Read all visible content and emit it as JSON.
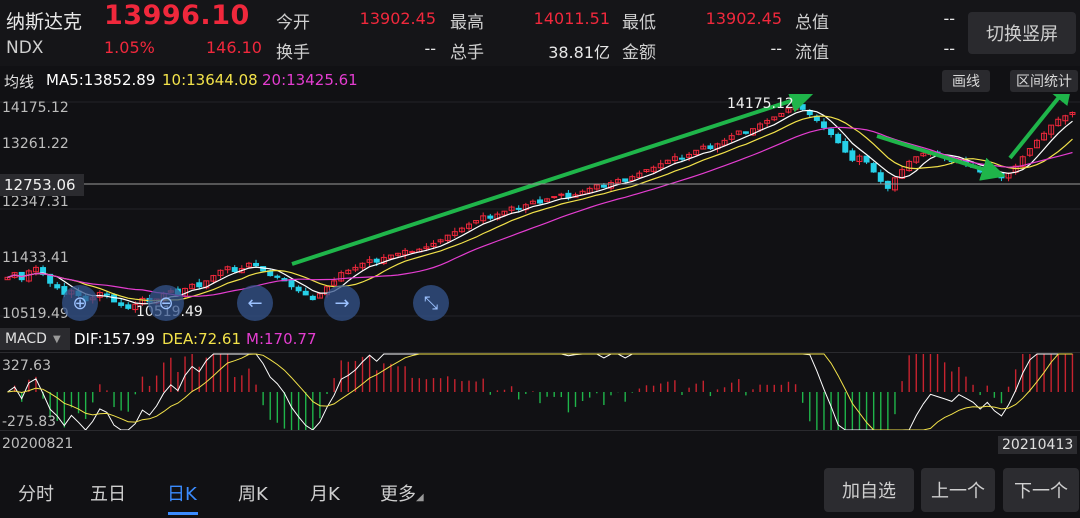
{
  "header": {
    "name": "纳斯达克",
    "price": "13996.10",
    "code": "NDX",
    "change_pct": "1.05%",
    "change": "146.10",
    "stats": [
      {
        "label": "今开",
        "value": "13902.45",
        "color": "red"
      },
      {
        "label": "最高",
        "value": "14011.51",
        "color": "red"
      },
      {
        "label": "最低",
        "value": "13902.45",
        "color": "red"
      },
      {
        "label": "总值",
        "value": "--",
        "color": "white"
      },
      {
        "label": "换手",
        "value": "--",
        "color": "white"
      },
      {
        "label": "总手",
        "value": "38.81亿",
        "color": "white"
      },
      {
        "label": "金额",
        "value": "--",
        "color": "white"
      },
      {
        "label": "流值",
        "value": "--",
        "color": "white"
      }
    ],
    "switch_button": "切换竖屏"
  },
  "ma": {
    "label": "均线",
    "ma5": "MA5:13852.89",
    "ma10": "10:13644.08",
    "ma20": "20:13425.61",
    "draw_button": "画线",
    "range_button": "区间统计"
  },
  "kline": {
    "y_labels": [
      "14175.12",
      "13261.22",
      "12347.31",
      "11433.41",
      "10519.49"
    ],
    "crosshair_value": "12753.06",
    "high_annotation": "14175.12",
    "low_annotation": "10519.49"
  },
  "macd": {
    "tag": "MACD",
    "dif": "DIF:157.99",
    "dea": "DEA:72.61",
    "m": "M:170.77",
    "y_top": "327.63",
    "y_bottom": "-275.83"
  },
  "dates": {
    "start": "20200821",
    "end": "20210413"
  },
  "tabs": [
    "分时",
    "五日",
    "日K",
    "周K",
    "月K",
    "更多"
  ],
  "active_tab": "日K",
  "bottom_buttons": [
    "加自选",
    "上一个",
    "下一个"
  ],
  "colors": {
    "up": "#f0283c",
    "down": "#27d0e8",
    "ma5": "#ffffff",
    "ma10": "#f2e24a",
    "ma20": "#e43dd0",
    "arrow": "#1fb54a",
    "accent": "#3b8cff"
  },
  "chart_data": {
    "type": "candlestick",
    "y_range": [
      10519.49,
      14175.12
    ],
    "closes": [
      11180,
      11260,
      11140,
      11290,
      11350,
      11230,
      11080,
      11000,
      10890,
      10950,
      10870,
      10780,
      10830,
      10920,
      10880,
      10760,
      10700,
      10650,
      10720,
      10820,
      10760,
      10810,
      10900,
      10950,
      10880,
      10990,
      11060,
      11020,
      11120,
      11210,
      11300,
      11360,
      11280,
      11330,
      11420,
      11380,
      11290,
      11210,
      11180,
      11120,
      11020,
      10950,
      10880,
      10800,
      10900,
      11020,
      11120,
      11260,
      11300,
      11350,
      11420,
      11480,
      11440,
      11520,
      11560,
      11590,
      11640,
      11620,
      11660,
      11700,
      11760,
      11820,
      11900,
      11960,
      12020,
      12090,
      12150,
      12230,
      12190,
      12260,
      12310,
      12380,
      12350,
      12420,
      12480,
      12450,
      12520,
      12560,
      12600,
      12540,
      12590,
      12650,
      12700,
      12760,
      12720,
      12800,
      12850,
      12820,
      12900,
      12960,
      13020,
      13060,
      13120,
      13180,
      13240,
      13200,
      13280,
      13350,
      13420,
      13380,
      13460,
      13520,
      13600,
      13680,
      13640,
      13720,
      13800,
      13860,
      13920,
      13980,
      14060,
      14110,
      14050,
      13960,
      13860,
      13740,
      13620,
      13480,
      13320,
      13180,
      13250,
      13150,
      12980,
      12820,
      12700,
      12880,
      13020,
      13160,
      13240,
      13300,
      13340,
      13280,
      13220,
      13160,
      13180,
      13120,
      13060,
      12980,
      13020,
      12940,
      12880,
      12960,
      13080,
      13240,
      13380,
      13520,
      13640,
      13780,
      13880,
      13940,
      13996
    ],
    "macd_dif_range": [
      -275.83,
      327.63
    ]
  }
}
